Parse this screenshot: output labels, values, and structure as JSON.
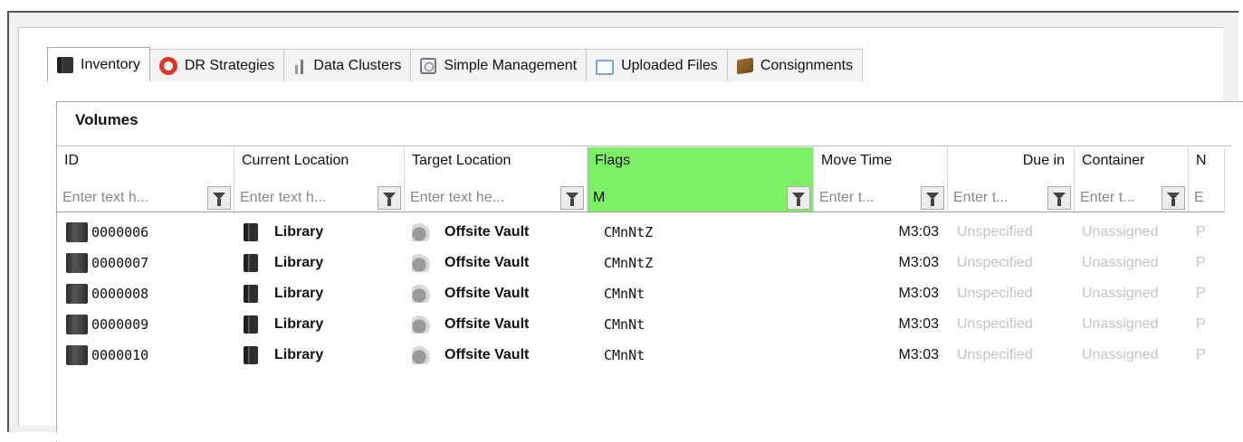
{
  "tabs": [
    {
      "label": "Inventory",
      "icon": "book-icon",
      "active": true
    },
    {
      "label": "DR Strategies",
      "icon": "lifebuoy-icon",
      "active": false
    },
    {
      "label": "Data Clusters",
      "icon": "bars-icon",
      "active": false
    },
    {
      "label": "Simple Management",
      "icon": "clock-icon",
      "active": false
    },
    {
      "label": "Uploaded Files",
      "icon": "window-icon",
      "active": false
    },
    {
      "label": "Consignments",
      "icon": "box-icon",
      "active": false
    }
  ],
  "panel": {
    "title": "Volumes"
  },
  "columns": [
    {
      "header": "ID",
      "placeholder": "Enter text h...",
      "value": ""
    },
    {
      "header": "Current Location",
      "placeholder": "Enter text h...",
      "value": ""
    },
    {
      "header": "Target Location",
      "placeholder": "Enter text he...",
      "value": ""
    },
    {
      "header": "Flags",
      "placeholder": "",
      "value": "M"
    },
    {
      "header": "Move Time",
      "placeholder": "Enter t...",
      "value": ""
    },
    {
      "header": "Due in",
      "placeholder": "Enter t...",
      "value": ""
    },
    {
      "header": "Container",
      "placeholder": "Enter t...",
      "value": ""
    },
    {
      "header": "N",
      "placeholder": "E",
      "value": ""
    }
  ],
  "rows": [
    {
      "id": "0000006",
      "current": "Library",
      "target": "Offsite Vault",
      "flags": "CMnNtZ",
      "move_time": "M3:03",
      "due_in": "Unspecified",
      "container": "Unassigned",
      "n": "P"
    },
    {
      "id": "0000007",
      "current": "Library",
      "target": "Offsite Vault",
      "flags": "CMnNtZ",
      "move_time": "M3:03",
      "due_in": "Unspecified",
      "container": "Unassigned",
      "n": "P"
    },
    {
      "id": "0000008",
      "current": "Library",
      "target": "Offsite Vault",
      "flags": "CMnNt",
      "move_time": "M3:03",
      "due_in": "Unspecified",
      "container": "Unassigned",
      "n": "P"
    },
    {
      "id": "0000009",
      "current": "Library",
      "target": "Offsite Vault",
      "flags": "CMnNt",
      "move_time": "M3:03",
      "due_in": "Unspecified",
      "container": "Unassigned",
      "n": "P"
    },
    {
      "id": "0000010",
      "current": "Library",
      "target": "Offsite Vault",
      "flags": "CMnNt",
      "move_time": "M3:03",
      "due_in": "Unspecified",
      "container": "Unassigned",
      "n": "P"
    }
  ],
  "colors": {
    "flags_filter_active": "#7cf064",
    "muted_text": "#c4c4c4"
  }
}
